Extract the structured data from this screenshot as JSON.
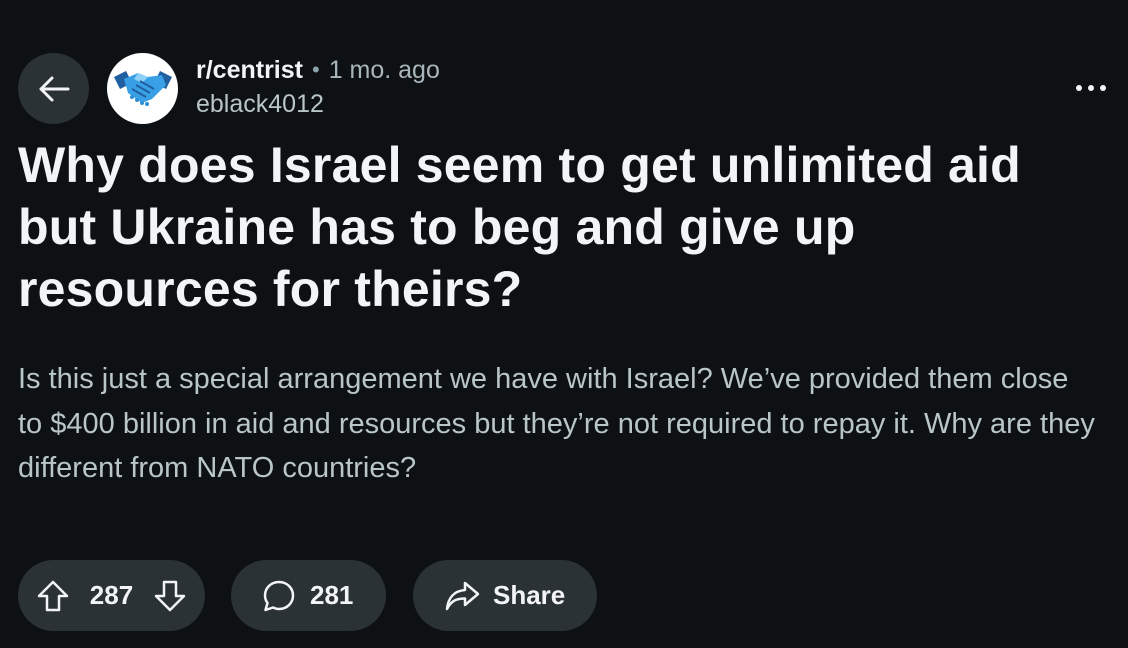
{
  "post": {
    "subreddit": "r/centrist",
    "separator": "•",
    "time_ago": "1 mo. ago",
    "author": "eblack4012",
    "title": "Why does Israel seem to get unlimited aid but Ukraine has to beg and give up resources for theirs?",
    "body": "Is this just a special arrangement we have with Israel? We’ve provided them close to $400 billion in aid and resources but they’re not required to repay it. Why are they different from NATO countries?"
  },
  "actions": {
    "upvotes": "287",
    "comments": "281",
    "share_label": "Share"
  },
  "icons": {
    "back": "arrow-left-icon",
    "avatar": "handshake-icon",
    "more": "more-horizontal-icon",
    "upvote": "arrow-up-icon",
    "downvote": "arrow-down-icon",
    "comment": "speech-bubble-icon",
    "share": "share-arrow-icon"
  },
  "colors": {
    "background": "#0e1113",
    "pill": "#2a3236",
    "text_primary": "#f2f4f5",
    "text_secondary": "#b8c5c9",
    "avatar_blue": "#2f8fd6"
  }
}
